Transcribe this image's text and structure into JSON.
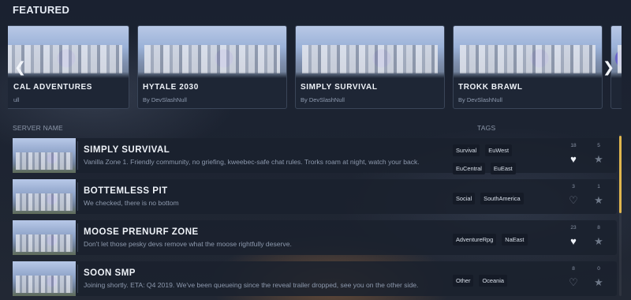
{
  "featured": {
    "title": "FEATURED",
    "cards": [
      {
        "name": "CAL ADVENTURES",
        "author": "ull"
      },
      {
        "name": "HYTALE 2030",
        "author": "By DevSlashNull"
      },
      {
        "name": "SIMPLY SURVIVAL",
        "author": "By DevSlashNull"
      },
      {
        "name": "TROKK BRAWL",
        "author": "By DevSlashNull"
      }
    ],
    "prev_icon": "chevron-left-icon",
    "next_icon": "chevron-right-icon"
  },
  "list": {
    "headers": {
      "server_name": "SERVER NAME",
      "tags": "TAGS"
    },
    "rows": [
      {
        "name": "SIMPLY SURVIVAL",
        "description": "Vanilla Zone 1. Friendly community, no griefing, kweebec-safe chat rules. Trorks roam at night, watch your back.",
        "tags": [
          "Survival",
          "EuWest",
          "EuCentral",
          "EuEast"
        ],
        "likes": "18",
        "favorites": "5",
        "liked": true
      },
      {
        "name": "BOTTEMLESS PIT",
        "description": "We checked, there is no bottom",
        "tags": [
          "Social",
          "SouthAmerica"
        ],
        "likes": "3",
        "favorites": "1",
        "liked": false
      },
      {
        "name": "MOOSE PRENURF ZONE",
        "description": "Don't let those pesky devs remove what the moose rightfully deserve.",
        "tags": [
          "AdventureRpg",
          "NaEast"
        ],
        "likes": "23",
        "favorites": "8",
        "liked": true
      },
      {
        "name": "SOON SMP",
        "description": "Joining shortly. ETA: Q4 2019. We've been queueing since the reveal trailer dropped, see you on the other side.",
        "tags": [
          "Other",
          "Oceania"
        ],
        "likes": "8",
        "favorites": "0",
        "liked": false
      }
    ]
  },
  "colors": {
    "accent": "#e0b64e",
    "background": "#151b26",
    "row_bg": "#1a212e"
  }
}
